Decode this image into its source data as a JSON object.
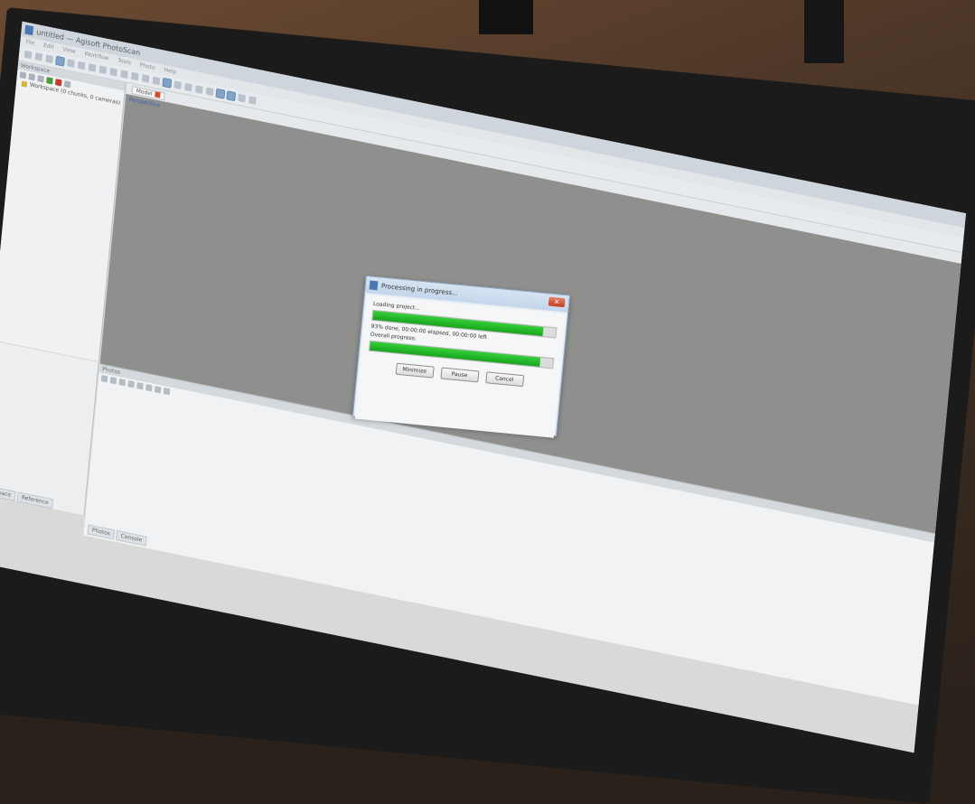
{
  "window": {
    "title": "untitled — Agisoft PhotoScan"
  },
  "menu": [
    "File",
    "Edit",
    "View",
    "Workflow",
    "Tools",
    "Photo",
    "Help"
  ],
  "workspace": {
    "header": "Workspace",
    "root_item": "Workspace (0 chunks, 0 cameras)",
    "tabs": [
      "Workspace",
      "Reference"
    ]
  },
  "model_view": {
    "tab_label": "Model",
    "overlay_label": "Perspective"
  },
  "photos": {
    "header": "Photos",
    "tabs": [
      "Photos",
      "Console"
    ]
  },
  "dialog": {
    "title": "Processing in progress...",
    "close_label": "✕",
    "task_label": "Loading project...",
    "task_progress": 0.93,
    "status_text": "93% done, 00:00:00 elapsed, 00:00:00 left",
    "overall_label": "Overall progress:",
    "overall_progress": 0.93,
    "buttons": {
      "minimize": "Minimize",
      "pause": "Pause",
      "cancel": "Cancel"
    }
  },
  "colors": {
    "progress_green": "#1db323",
    "viewport_gray": "#8f8f8e",
    "close_red": "#c43c20"
  }
}
